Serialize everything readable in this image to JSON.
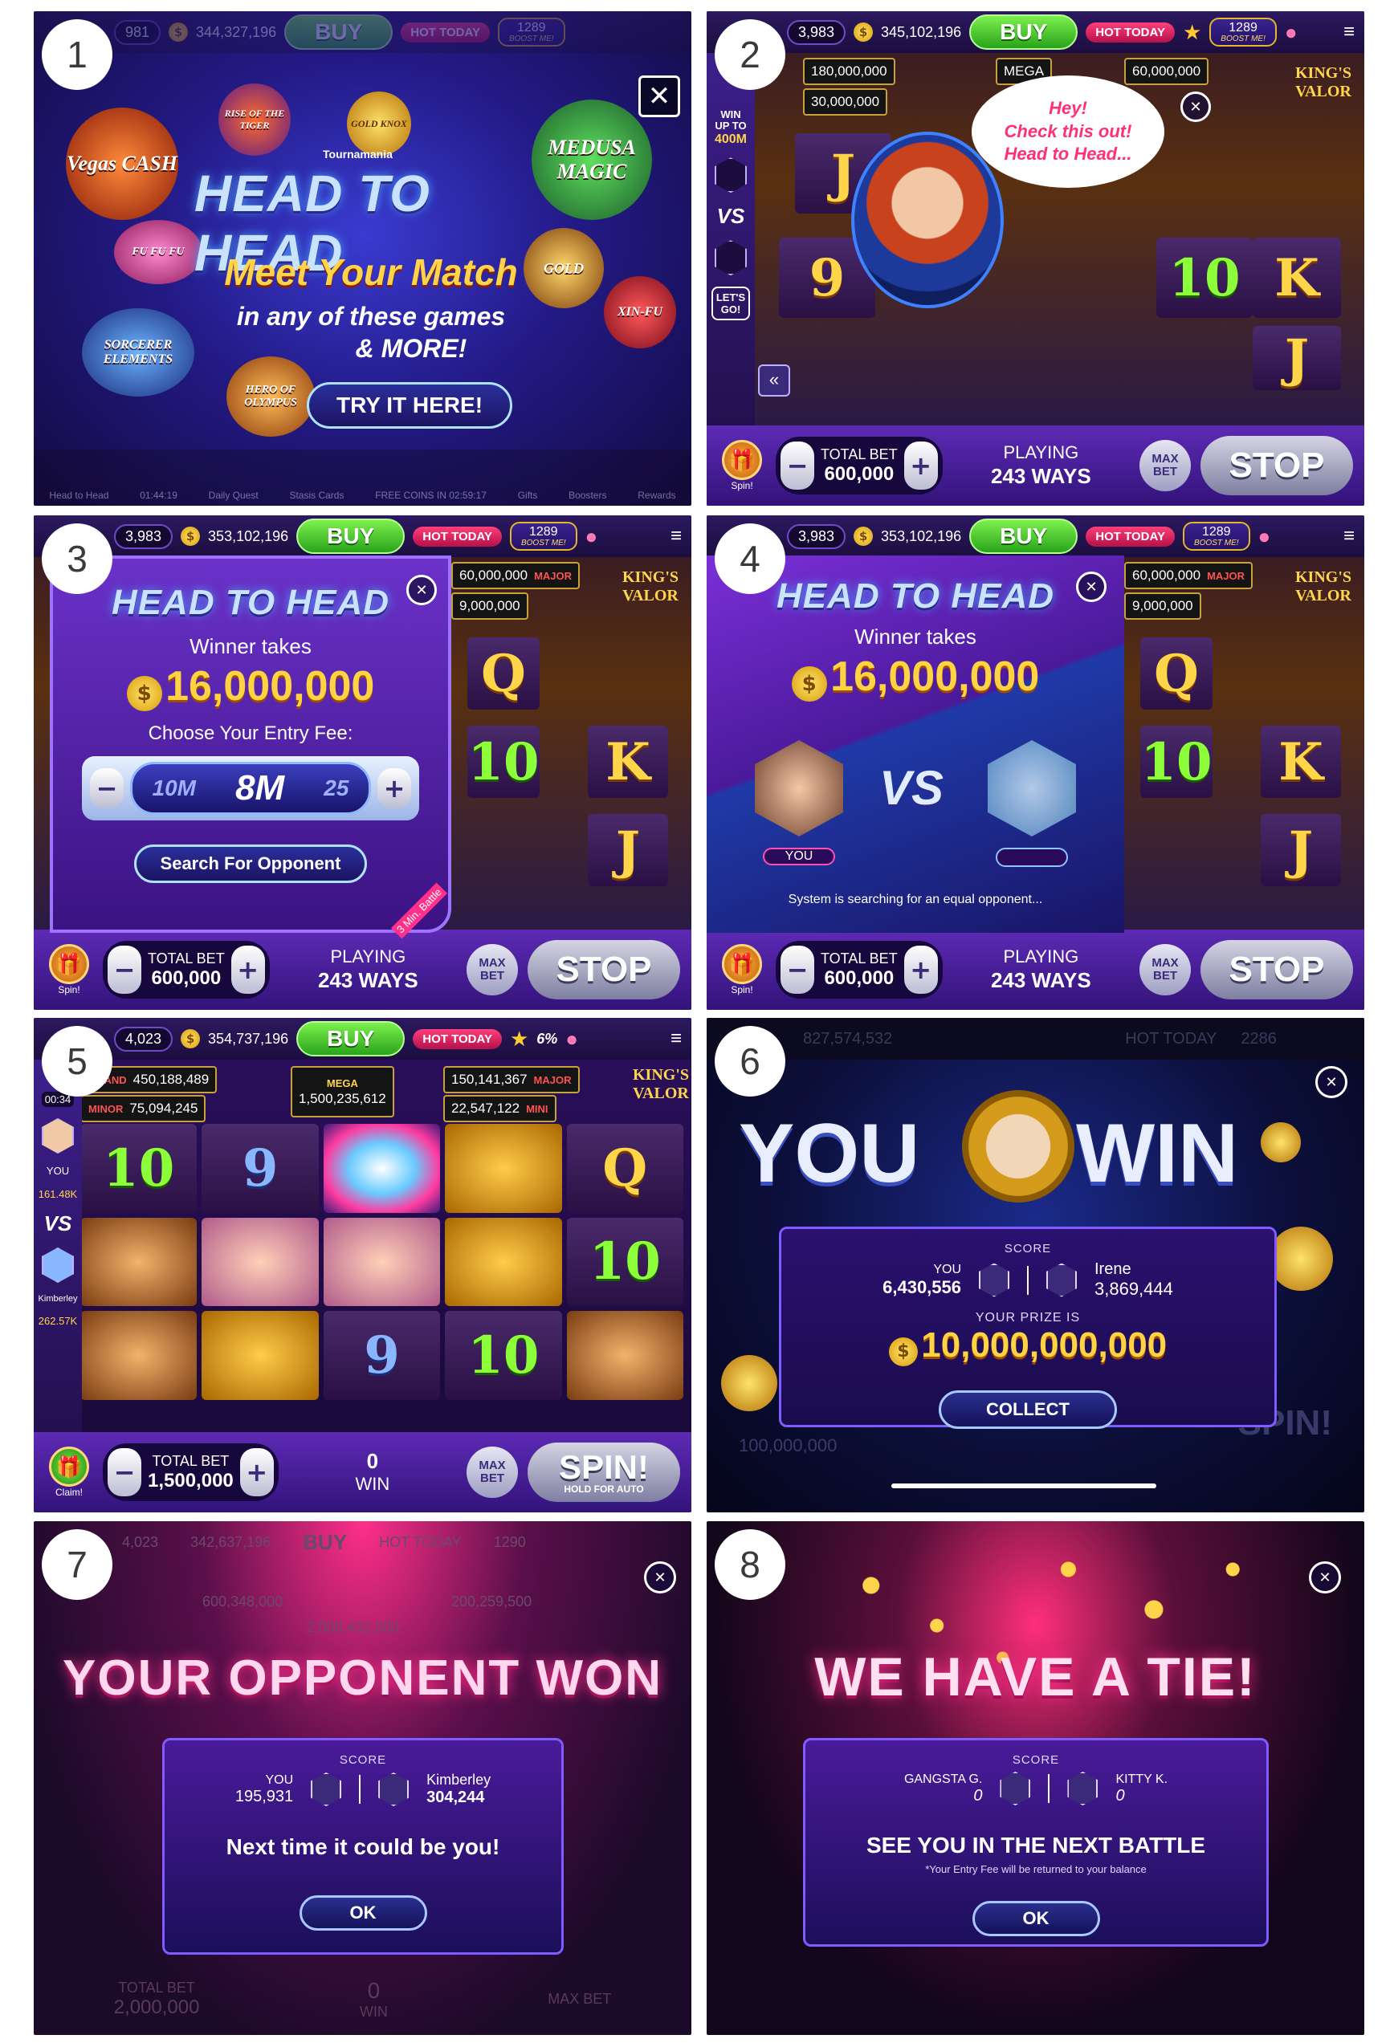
{
  "panel_numbers": [
    "1",
    "2",
    "3",
    "4",
    "5",
    "6",
    "7",
    "8"
  ],
  "icons": {
    "close": "close-icon",
    "coin": "coin-icon",
    "star": "star-icon",
    "piggy": "piggy-bank-icon",
    "menu": "menu-icon",
    "gift": "gift-icon",
    "collapse": "double-chevron-left-icon"
  },
  "p1": {
    "top": {
      "balance_a": "981",
      "balance_b": "344,327,196",
      "buy": "BUY",
      "hot": "HOT TODAY",
      "level": "1289",
      "boost": "BOOST ME!"
    },
    "brand_small": "Tournamania",
    "title": "HEAD TO HEAD",
    "headline": "Meet Your Match",
    "sub1": "in any of these games",
    "sub2": "& MORE!",
    "cta": "TRY IT HERE!",
    "games": [
      "Vegas CASH",
      "RISE OF THE TIGER",
      "GOLD KNOX",
      "MEDUSA MAGIC",
      "FU FU FU",
      "SORCERER ELEMENTS",
      "HERO OF OLYMPUS",
      "GOLD",
      "XIN-FU"
    ],
    "footer": {
      "tab1": "Head to Head",
      "timer1": "01:44:19",
      "tab2": "Daily Quest",
      "tab3": "Stasis Cards",
      "free": "FREE COINS IN 02:59:17",
      "tab4": "Gifts",
      "tab5": "Boosters",
      "tab6": "Rewards"
    }
  },
  "p2": {
    "top": {
      "balance_a": "3,983",
      "balance_b": "345,102,196",
      "buy": "BUY",
      "hot": "HOT TODAY",
      "level": "1289",
      "boost": "BOOST ME!"
    },
    "rail": {
      "win": "WIN",
      "up": "UP TO",
      "amount": "400M",
      "vs": "VS",
      "lets": "LET'S GO!"
    },
    "speech": [
      "Hey!",
      "Check this out!",
      "Head to Head..."
    ],
    "jackpot_1": "180,000,000",
    "jackpot_2": "30,000,000",
    "jackpot_3": "60,000,000",
    "jackpot_tag": "MEGA",
    "machine": "KING'S VALOR",
    "reels": [
      "J",
      "9",
      "10",
      "K",
      "J"
    ],
    "bottom": {
      "spin": "Spin!",
      "total_bet_label": "TOTAL BET",
      "total_bet": "600,000",
      "playing": "PLAYING",
      "ways": "243 WAYS",
      "max": "MAX BET",
      "stop": "STOP"
    }
  },
  "p3": {
    "top": {
      "balance_a": "3,983",
      "balance_b": "353,102,196",
      "buy": "BUY",
      "hot": "HOT TODAY",
      "level": "1289",
      "boost": "BOOST ME!"
    },
    "title": "HEAD TO HEAD",
    "winner_takes": "Winner takes",
    "prize": "16,000,000",
    "choose": "Choose Your Entry Fee:",
    "fee_left": "10M",
    "fee": "8M",
    "fee_right": "25",
    "search": "Search For Opponent",
    "corner": "3 Min. Battle",
    "jackpot_1": "60,000,000",
    "jackpot_2": "9,000,000",
    "jackpot_tag": "MAJOR",
    "machine": "KING'S VALOR",
    "reels": [
      "Q",
      "10",
      "K",
      "J"
    ],
    "bottom": {
      "spin": "Spin!",
      "total_bet_label": "TOTAL BET",
      "total_bet": "600,000",
      "playing": "PLAYING",
      "ways": "243 WAYS",
      "max": "MAX BET",
      "stop": "STOP"
    }
  },
  "p4": {
    "top": {
      "balance_a": "3,983",
      "balance_b": "353,102,196",
      "buy": "BUY",
      "hot": "HOT TODAY",
      "level": "1289",
      "boost": "BOOST ME!"
    },
    "title": "HEAD TO HEAD",
    "winner_takes": "Winner takes",
    "prize": "16,000,000",
    "vs": "VS",
    "you": "YOU",
    "searching": "System is searching for an equal opponent...",
    "jackpot_1": "60,000,000",
    "jackpot_2": "9,000,000",
    "jackpot_tag": "MAJOR",
    "machine": "KING'S VALOR",
    "reels": [
      "Q",
      "10",
      "K",
      "J"
    ],
    "bottom": {
      "spin": "Spin!",
      "total_bet_label": "TOTAL BET",
      "total_bet": "600,000",
      "playing": "PLAYING",
      "ways": "243 WAYS",
      "max": "MAX BET",
      "stop": "STOP"
    }
  },
  "p5": {
    "top": {
      "balance_a": "4,023",
      "balance_b": "354,737,196",
      "buy": "BUY",
      "hot": "HOT TODAY",
      "level": "6%"
    },
    "rail": {
      "timer": "00:34",
      "you": "YOU",
      "you_score": "161.48K",
      "vs": "VS",
      "opp": "Kimberley",
      "opp_score": "262.57K"
    },
    "jackpots": [
      {
        "tag": "GRAND",
        "value": "450,188,489"
      },
      {
        "tag": "MINOR",
        "value": "75,094,245"
      },
      {
        "tag": "MEGA",
        "value": "1,500,235,612"
      },
      {
        "tag": "MAJOR",
        "value": "150,141,367"
      },
      {
        "tag": "MINI",
        "value": "22,547,122"
      }
    ],
    "machine": "KING'S VALOR",
    "reels": [
      "10",
      "9",
      "",
      "",
      "Q",
      "",
      "",
      "",
      "",
      "10",
      "",
      "",
      "9",
      "10",
      ""
    ],
    "bottom": {
      "spin": "Claim!",
      "total_bet_label": "TOTAL BET",
      "total_bet": "1,500,000",
      "win_value": "0",
      "win_label": "WIN",
      "max": "MAX BET",
      "spin_btn": "SPIN!",
      "hold": "HOLD FOR AUTO"
    }
  },
  "p6": {
    "faded_balance": "827,574,532",
    "faded_hot": "HOT TODAY",
    "faded_level": "2286",
    "you": "YOU",
    "win": "WIN",
    "score_label": "SCORE",
    "player_you": "YOU",
    "player_you_score": "6,430,556",
    "player_opp": "Irene",
    "player_opp_score": "3,869,444",
    "prize_label": "YOUR PRIZE IS",
    "prize": "10,000,000,000",
    "collect": "COLLECT",
    "faded_bet": "100,000,000",
    "faded_spin": "SPIN!"
  },
  "p7": {
    "faded_top": {
      "balance_a": "4,023",
      "balance_b": "342,637,196",
      "buy": "BUY",
      "hot": "HOT TODAY",
      "level": "1290"
    },
    "faded_jackpot_1": "600,348,000",
    "faded_jackpot_2": "200,259,500",
    "faded_jackpot_3": "2,000,432,500",
    "title": "YOUR OPPONENT WON",
    "score_label": "SCORE",
    "player_you": "YOU",
    "player_you_score": "195,931",
    "player_opp": "Kimberley",
    "player_opp_score": "304,244",
    "message": "Next time it could be you!",
    "ok": "OK",
    "faded_bet_label": "TOTAL BET",
    "faded_bet": "2,000,000",
    "faded_win": "0",
    "faded_win_label": "WIN",
    "faded_max": "MAX BET"
  },
  "p8": {
    "title": "WE HAVE A TIE!",
    "score_label": "SCORE",
    "player_a": "GANGSTA G.",
    "player_a_score": "0",
    "player_b": "KITTY K.",
    "player_b_score": "0",
    "message": "SEE YOU IN THE NEXT BATTLE",
    "note": "*Your Entry Fee will be returned to your balance",
    "ok": "OK"
  }
}
